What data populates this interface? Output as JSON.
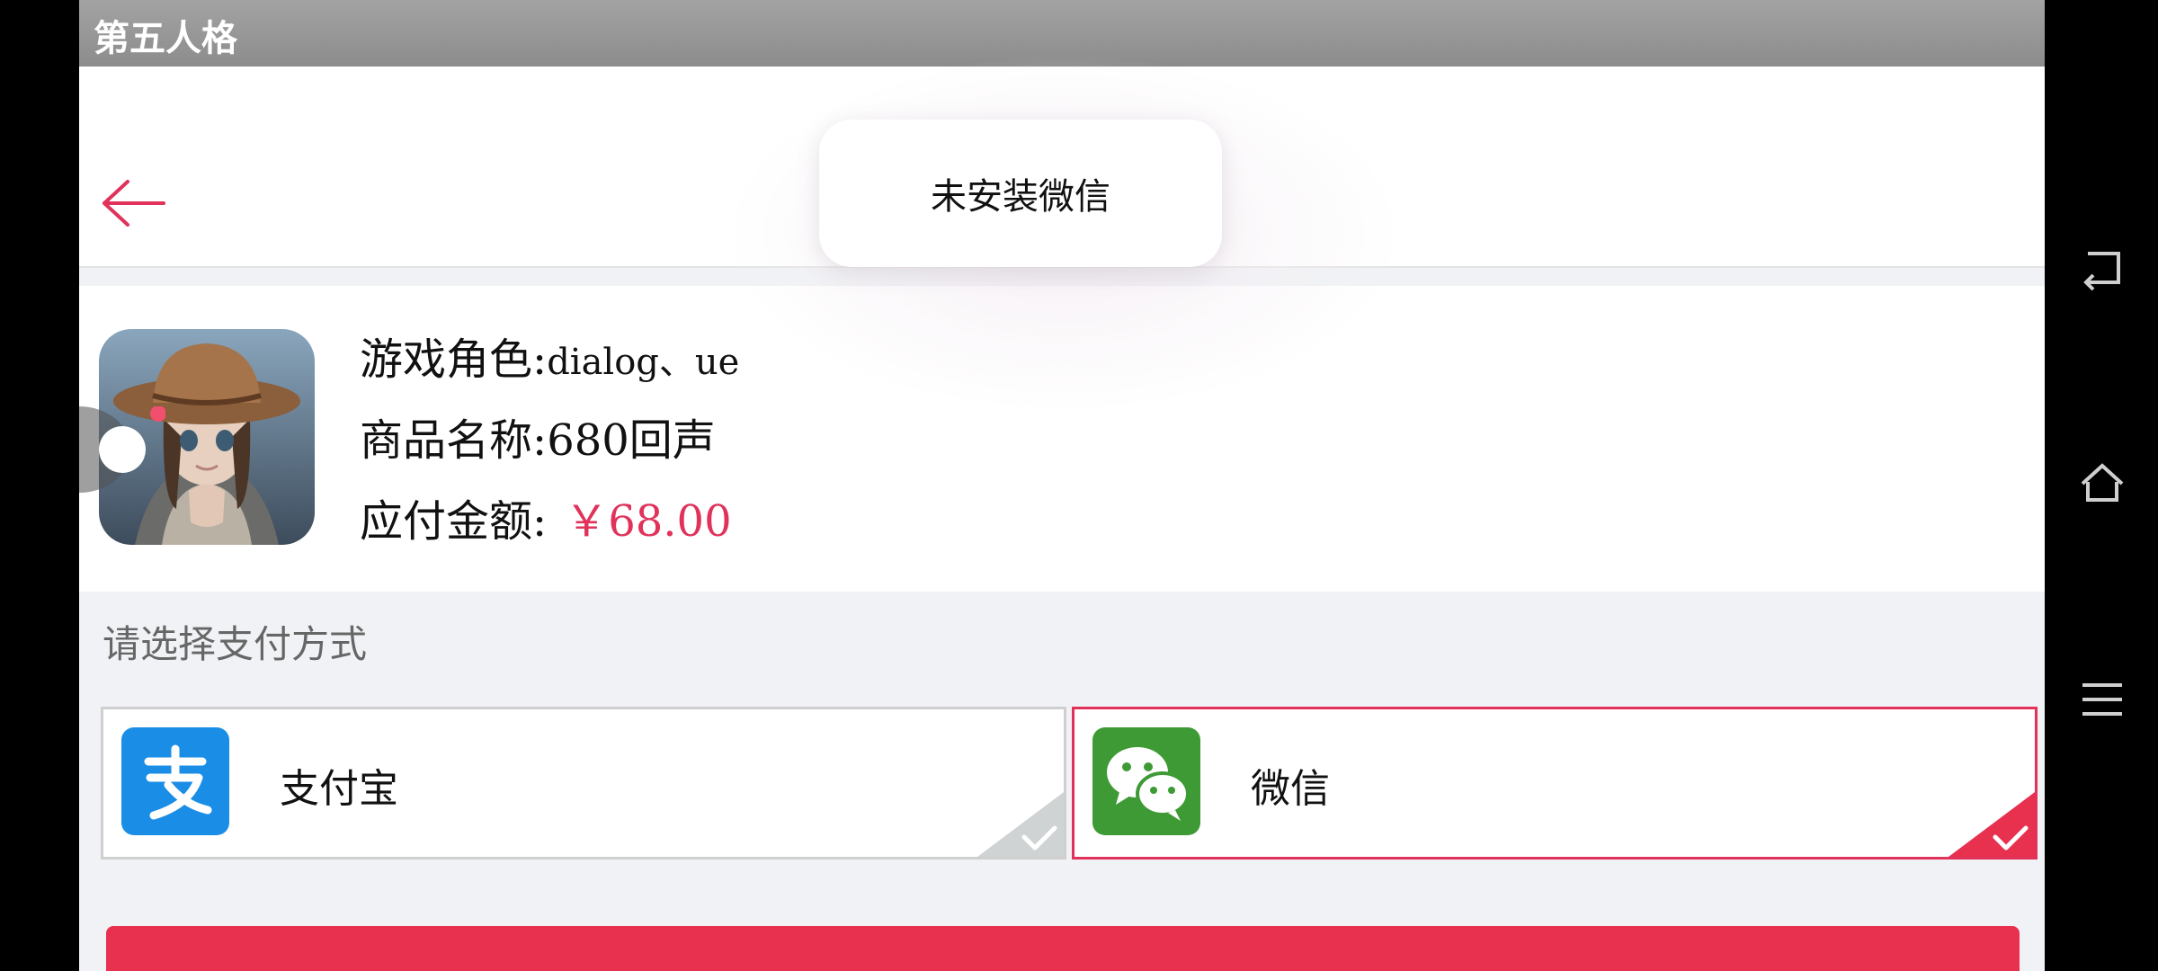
{
  "titlebar": {
    "title": "第五人格"
  },
  "toast": {
    "message": "未安装微信"
  },
  "order": {
    "role_label": "游戏角色:",
    "role_value": "dialog、ue",
    "product_label": "商品名称:",
    "product_value": "680回声",
    "amount_label": "应付金额:",
    "amount_value": "￥68.00"
  },
  "payment": {
    "prompt": "请选择支付方式",
    "methods": [
      {
        "label": "支付宝",
        "selected": false,
        "icon": "alipay-logo"
      },
      {
        "label": "微信",
        "selected": true,
        "icon": "wechat-logo"
      }
    ]
  },
  "colors": {
    "accent": "#e0325a",
    "alipay_blue": "#1a8ee6",
    "wechat_green": "#3e9a35"
  },
  "navbar": {
    "icons": [
      "back-icon",
      "home-icon",
      "menu-icon"
    ]
  }
}
